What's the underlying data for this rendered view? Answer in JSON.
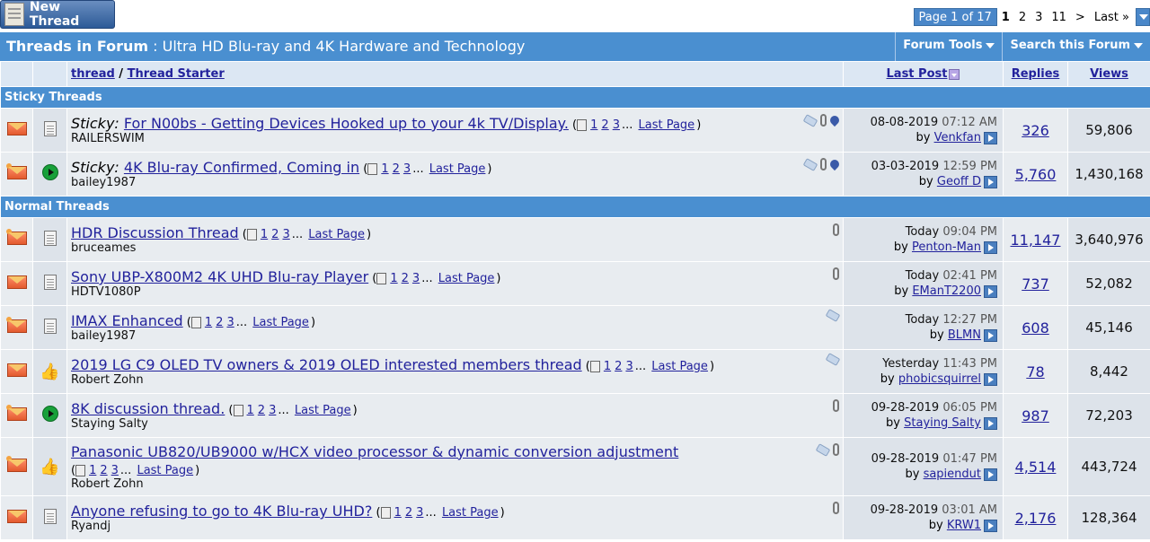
{
  "top": {
    "new_thread_label": "New Thread",
    "pagenav": {
      "label": "Page 1 of 17",
      "pages": [
        "1",
        "2",
        "3",
        "11",
        ">",
        "Last »"
      ]
    }
  },
  "forum": {
    "prefix": "Threads in Forum",
    "separator": " : ",
    "name": "Ultra HD Blu-ray and 4K Hardware and Technology",
    "tools_label": "Forum Tools",
    "search_label": "Search this Forum"
  },
  "columns": {
    "thread": "thread",
    "slash": " / ",
    "starter": "Thread Starter",
    "last_post": "Last Post",
    "replies": "Replies",
    "views": "Views"
  },
  "sections": {
    "sticky": "Sticky Threads",
    "normal": "Normal Threads"
  },
  "sticky_prefix": "Sticky: ",
  "last_page_label": "Last Page",
  "by_label": "by",
  "threads": [
    {
      "sticky": true,
      "status": "env",
      "post_icon": "doc",
      "title": "For N00bs - Getting Devices Hooked up to your 4k TV/Display.",
      "pages": [
        "1",
        "2",
        "3"
      ],
      "starter": "RAILERSWIM",
      "icons": [
        "tag",
        "clip",
        "pin"
      ],
      "date": "08-08-2019",
      "time": "07:12 AM",
      "user": "Venkfan",
      "replies": "326",
      "views": "59,806"
    },
    {
      "sticky": true,
      "status": "env-hot",
      "post_icon": "arrow",
      "title": "4K Blu-ray Confirmed, Coming in",
      "pages": [
        "1",
        "2",
        "3"
      ],
      "starter": "bailey1987",
      "icons": [
        "tag",
        "clip",
        "pin"
      ],
      "date": "03-03-2019",
      "time": "12:59 PM",
      "user": "Geoff D",
      "replies": "5,760",
      "views": "1,430,168"
    },
    {
      "sticky": false,
      "status": "env-hot",
      "post_icon": "doc",
      "title": "HDR Discussion Thread",
      "pages": [
        "1",
        "2",
        "3"
      ],
      "starter": "bruceames",
      "icons": [
        "clip"
      ],
      "date": "Today",
      "time": "09:04 PM",
      "user": "Penton-Man",
      "replies": "11,147",
      "views": "3,640,976"
    },
    {
      "sticky": false,
      "status": "env",
      "post_icon": "doc",
      "title": "Sony UBP-X800M2 4K UHD Blu-ray Player",
      "pages": [
        "1",
        "2",
        "3"
      ],
      "starter": "HDTV1080P",
      "icons": [
        "clip"
      ],
      "date": "Today",
      "time": "02:41 PM",
      "user": "EManT2200",
      "replies": "737",
      "views": "52,082"
    },
    {
      "sticky": false,
      "status": "env-hot",
      "post_icon": "doc",
      "title": "IMAX Enhanced",
      "pages": [
        "1",
        "2",
        "3"
      ],
      "starter": "bailey1987",
      "icons": [
        "tag"
      ],
      "date": "Today",
      "time": "12:27 PM",
      "user": "BLMN",
      "replies": "608",
      "views": "45,146"
    },
    {
      "sticky": false,
      "status": "env",
      "post_icon": "thumb",
      "title": "2019 LG C9 OLED TV owners & 2019 OLED interested members thread",
      "pages": [
        "1",
        "2",
        "3"
      ],
      "starter": "Robert Zohn",
      "icons": [
        "tag"
      ],
      "date": "Yesterday",
      "time": "11:43 PM",
      "user": "phobicsquirrel",
      "replies": "78",
      "views": "8,442"
    },
    {
      "sticky": false,
      "status": "env-hot",
      "post_icon": "arrow",
      "title": "8K discussion thread.",
      "pages": [
        "1",
        "2",
        "3"
      ],
      "starter": "Staying Salty",
      "icons": [
        "clip"
      ],
      "date": "09-28-2019",
      "time": "06:05 PM",
      "user": "Staying Salty",
      "replies": "987",
      "views": "72,203"
    },
    {
      "sticky": false,
      "status": "env-hot",
      "post_icon": "thumb",
      "title": "Panasonic UB820/UB9000 w/HCX video processor & dynamic conversion adjustment",
      "pages": [
        "1",
        "2",
        "3"
      ],
      "pages_wrap": true,
      "starter": "Robert Zohn",
      "icons": [
        "tag",
        "clip"
      ],
      "date": "09-28-2019",
      "time": "01:47 PM",
      "user": "sapiendut",
      "replies": "4,514",
      "views": "443,724"
    },
    {
      "sticky": false,
      "status": "env",
      "post_icon": "doc",
      "title": "Anyone refusing to go to 4K Blu-ray UHD?",
      "pages": [
        "1",
        "2",
        "3"
      ],
      "starter": "Ryandj",
      "icons": [
        "clip"
      ],
      "date": "09-28-2019",
      "time": "03:01 AM",
      "user": "KRW1",
      "replies": "2,176",
      "views": "128,364"
    }
  ]
}
